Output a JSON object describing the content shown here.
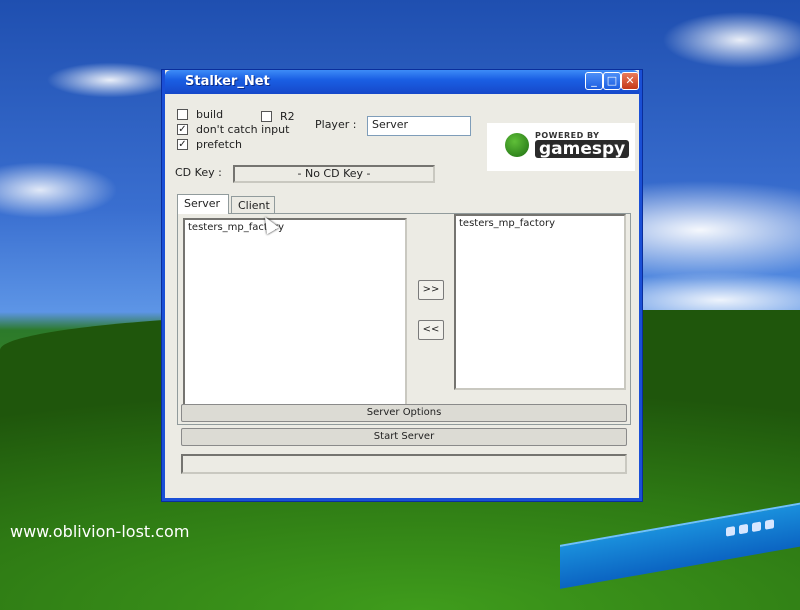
{
  "window": {
    "title": "Stalker_Net"
  },
  "options": {
    "build": {
      "label": "build",
      "checked": false
    },
    "r2": {
      "label": "R2",
      "checked": false
    },
    "dont_catch_input": {
      "label": "don't catch input",
      "checked": true
    },
    "prefetch": {
      "label": "prefetch",
      "checked": true
    }
  },
  "player": {
    "label": "Player :",
    "value": "Server"
  },
  "cdkey": {
    "label": "CD Key :",
    "value": "- No CD Key -"
  },
  "logo": {
    "small": "POWERED BY",
    "big": "gamespy"
  },
  "tabs": [
    {
      "label": "Server",
      "active": true
    },
    {
      "label": "Client",
      "active": false
    }
  ],
  "maps": {
    "available": [
      "testers_mp_factory"
    ],
    "selected": [
      "testers_mp_factory"
    ]
  },
  "buttons": {
    "add": ">>",
    "remove": "<<",
    "server_options": "Server Options",
    "start_server": "Start Server"
  },
  "watermark": "www.oblivion-lost.com"
}
